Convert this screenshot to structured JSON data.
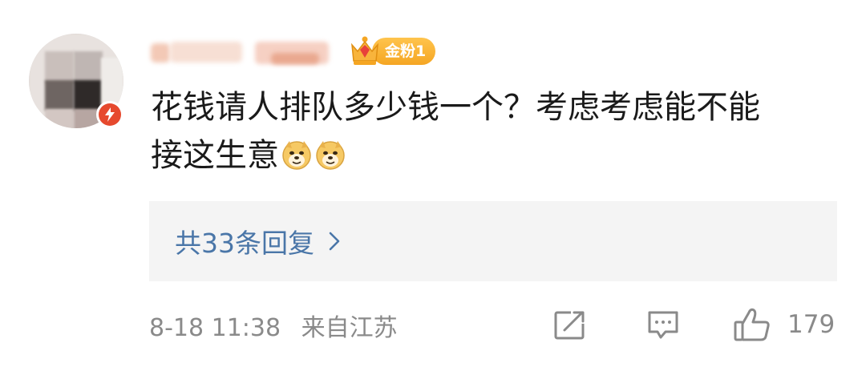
{
  "comment": {
    "fan_badge_label": "金粉1",
    "text_line1": "花钱请人排队多少钱一个？考虑考虑能不能",
    "text_line2": "接这生意",
    "emojis": [
      "doge-emoji",
      "doge-emoji"
    ]
  },
  "replies": {
    "label": "共33条回复"
  },
  "footer": {
    "timestamp": "8-18 11:38",
    "location": "来自江苏",
    "like_count": "179"
  },
  "colors": {
    "link_blue": "#4a76a8",
    "meta_gray": "#8a8a8a",
    "badge_orange": "#f5a623",
    "reply_bg": "#f4f4f4"
  }
}
